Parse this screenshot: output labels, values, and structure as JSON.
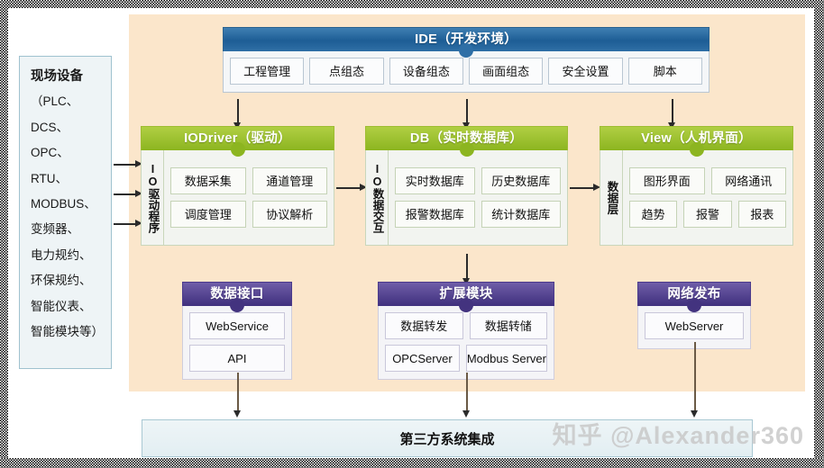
{
  "canvas": {
    "bg": "#fbe6cb",
    "frame": "#ffffff"
  },
  "field_devices": {
    "title": "现场设备",
    "lines": [
      "现场设备",
      "（PLC、",
      "DCS、",
      "OPC、",
      "RTU、",
      "MODBUS、",
      "变频器、",
      "电力规约、",
      "环保规约、",
      "智能仪表、",
      "智能模块等）"
    ]
  },
  "ide": {
    "title": "IDE（开发环境）",
    "color": "#1d5d95",
    "buttons": [
      "工程管理",
      "点组态",
      "设备组态",
      "画面组态",
      "安全设置",
      "脚本"
    ]
  },
  "iodriver": {
    "title": "IODriver（驱动）",
    "color": "#8cb520",
    "side_label": "IO驱动程序",
    "row1": [
      "数据采集",
      "通道管理"
    ],
    "row2": [
      "调度管理",
      "协议解析"
    ]
  },
  "db": {
    "title": "DB（实时数据库）",
    "color": "#8cb520",
    "side_label": "IO数据交互",
    "row1": [
      "实时数据库",
      "历史数据库"
    ],
    "row2": [
      "报警数据库",
      "统计数据库"
    ]
  },
  "view": {
    "title": "View（人机界面）",
    "color": "#8cb520",
    "side_label": "数据层",
    "row1": [
      "图形界面",
      "网络通讯"
    ],
    "row2": [
      "趋势",
      "报警",
      "报表"
    ]
  },
  "data_interface": {
    "title": "数据接口",
    "color": "#43337f",
    "row1": [
      "WebService"
    ],
    "row2": [
      "API"
    ]
  },
  "extension": {
    "title": "扩展模块",
    "color": "#43337f",
    "row1": [
      "数据转发",
      "数据转储"
    ],
    "row2": [
      "OPCServer",
      "Modbus Server"
    ]
  },
  "web_publish": {
    "title": "网络发布",
    "color": "#43337f",
    "row1": [
      "WebServer"
    ]
  },
  "integration": {
    "label": "第三方系统集成"
  },
  "watermark": {
    "text": "知乎 @Alexander360"
  }
}
